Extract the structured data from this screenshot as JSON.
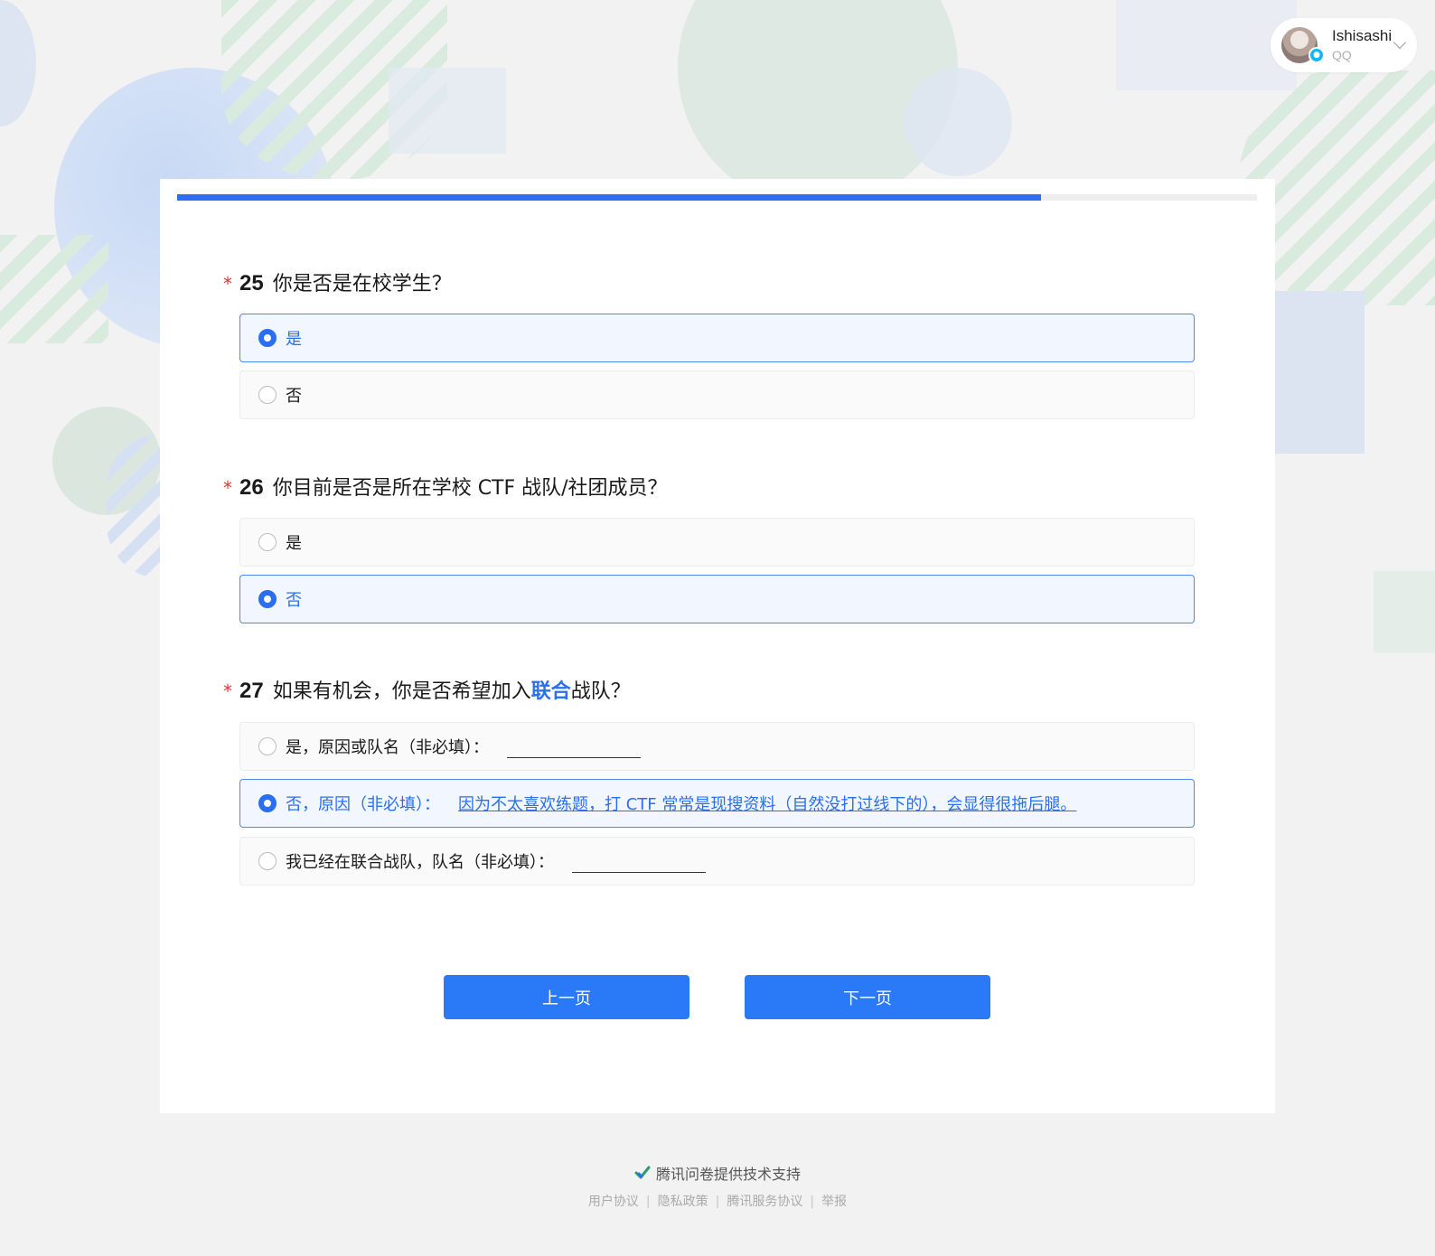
{
  "user": {
    "name": "Ishisashi",
    "source": "QQ"
  },
  "progress": 0.8,
  "questions": [
    {
      "star": "*",
      "number": "25",
      "text": "你是否是在校学生？",
      "options": [
        {
          "label": "是",
          "selected": true
        },
        {
          "label": "否",
          "selected": false
        }
      ]
    },
    {
      "star": "*",
      "number": "26",
      "text": "你目前是否是所在学校 CTF 战队/社团成员？",
      "options": [
        {
          "label": "是",
          "selected": false
        },
        {
          "label": "否",
          "selected": true
        }
      ]
    },
    {
      "star": "*",
      "number": "27",
      "text_before": "如果有机会，你是否希望加入",
      "text_highlight": "联合",
      "text_after": "战队？",
      "options": [
        {
          "label": "是，原因或队名（非必填）：",
          "selected": false,
          "value": ""
        },
        {
          "label": "否，原因（非必填）：",
          "selected": true,
          "value": "因为不太喜欢练题，打 CTF 常常是现搜资料（自然没打过线下的），会显得很拖后腿。"
        },
        {
          "label": "我已经在联合战队，队名（非必填）：",
          "selected": false,
          "value": ""
        }
      ]
    }
  ],
  "buttons": {
    "prev": "上一页",
    "next": "下一页"
  },
  "footer": {
    "powered_by": "腾讯问卷提供技术支持",
    "links": [
      "用户协议",
      "隐私政策",
      "腾讯服务协议",
      "举报"
    ],
    "separator": "|"
  },
  "colors": {
    "accent": "#2a6ff0",
    "required_star": "#e03535",
    "background": "#f2f2f2"
  }
}
